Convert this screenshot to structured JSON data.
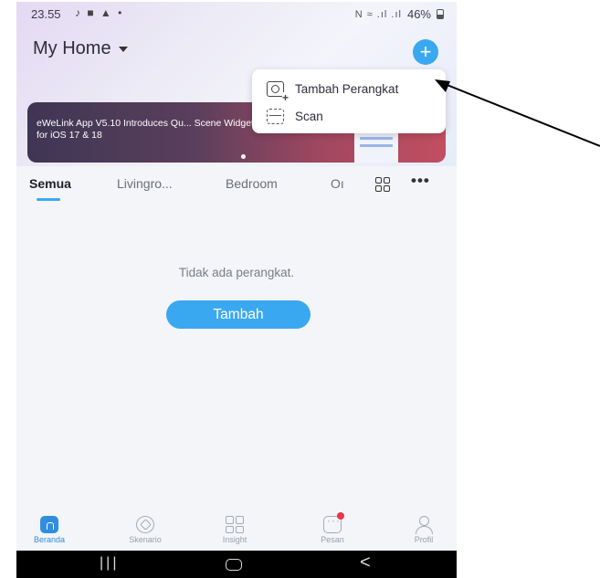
{
  "status_bar": {
    "time": "23.55",
    "left_icons": "♪ ■ ▲ •",
    "right_icons": "N ≈ .ıl .ıl",
    "battery": "46%"
  },
  "header": {
    "home_name": "My Home"
  },
  "banner": {
    "text": "eWeLink App V5.10 Introduces Qu... Scene Widgets for iOS 17 & 18"
  },
  "add_menu": {
    "items": [
      {
        "label": "Tambah Perangkat",
        "icon": "add-device-icon"
      },
      {
        "label": "Scan",
        "icon": "scan-icon"
      }
    ]
  },
  "tabs": [
    "Semua",
    "Livingro...",
    "Bedroom",
    "Oı"
  ],
  "empty_state": {
    "message": "Tidak ada perangkat.",
    "button": "Tambah"
  },
  "bottom_nav": [
    {
      "label": "Beranda",
      "icon": "home-icon",
      "active": true
    },
    {
      "label": "Skenario",
      "icon": "scene-icon",
      "active": false
    },
    {
      "label": "Insight",
      "icon": "insight-icon",
      "active": false
    },
    {
      "label": "Pesan",
      "icon": "message-icon",
      "active": false
    },
    {
      "label": "Profil",
      "icon": "profile-icon",
      "active": false
    }
  ],
  "colors": {
    "accent": "#3aa8f0",
    "background": "#f3f5f8",
    "notification_dot": "#e8344c"
  }
}
